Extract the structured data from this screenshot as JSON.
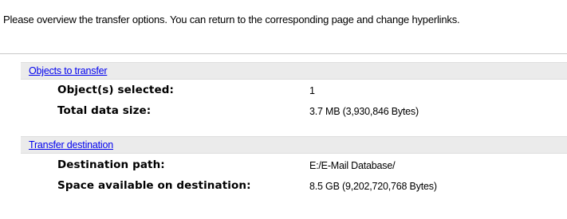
{
  "intro": {
    "text": "Please overview the transfer options. You can return to the corresponding page and change hyperlinks."
  },
  "sections": [
    {
      "title": "Objects to transfer",
      "rows": [
        {
          "label": "Object(s) selected:",
          "value": "1"
        },
        {
          "label": "Total data size:",
          "value": "3.7 MB (3,930,846 Bytes)"
        }
      ]
    },
    {
      "title": "Transfer destination",
      "rows": [
        {
          "label": "Destination path:",
          "value": "E:/E-Mail Database/"
        },
        {
          "label": "Space available on destination:",
          "value": "8.5 GB (9,202,720,768 Bytes)"
        }
      ]
    }
  ],
  "colors": {
    "link": "#0000ee",
    "section_bg": "#ebebeb"
  }
}
